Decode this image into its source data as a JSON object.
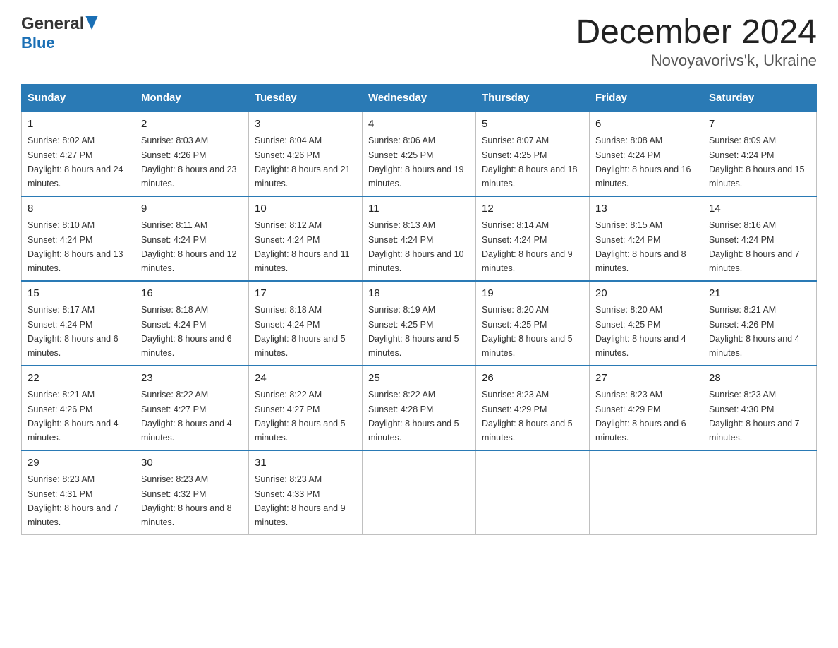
{
  "header": {
    "title": "December 2024",
    "subtitle": "Novoyavorivs'k, Ukraine",
    "logo_general": "General",
    "logo_blue": "Blue"
  },
  "weekdays": [
    "Sunday",
    "Monday",
    "Tuesday",
    "Wednesday",
    "Thursday",
    "Friday",
    "Saturday"
  ],
  "weeks": [
    [
      {
        "day": "1",
        "sunrise": "8:02 AM",
        "sunset": "4:27 PM",
        "daylight": "8 hours and 24 minutes."
      },
      {
        "day": "2",
        "sunrise": "8:03 AM",
        "sunset": "4:26 PM",
        "daylight": "8 hours and 23 minutes."
      },
      {
        "day": "3",
        "sunrise": "8:04 AM",
        "sunset": "4:26 PM",
        "daylight": "8 hours and 21 minutes."
      },
      {
        "day": "4",
        "sunrise": "8:06 AM",
        "sunset": "4:25 PM",
        "daylight": "8 hours and 19 minutes."
      },
      {
        "day": "5",
        "sunrise": "8:07 AM",
        "sunset": "4:25 PM",
        "daylight": "8 hours and 18 minutes."
      },
      {
        "day": "6",
        "sunrise": "8:08 AM",
        "sunset": "4:24 PM",
        "daylight": "8 hours and 16 minutes."
      },
      {
        "day": "7",
        "sunrise": "8:09 AM",
        "sunset": "4:24 PM",
        "daylight": "8 hours and 15 minutes."
      }
    ],
    [
      {
        "day": "8",
        "sunrise": "8:10 AM",
        "sunset": "4:24 PM",
        "daylight": "8 hours and 13 minutes."
      },
      {
        "day": "9",
        "sunrise": "8:11 AM",
        "sunset": "4:24 PM",
        "daylight": "8 hours and 12 minutes."
      },
      {
        "day": "10",
        "sunrise": "8:12 AM",
        "sunset": "4:24 PM",
        "daylight": "8 hours and 11 minutes."
      },
      {
        "day": "11",
        "sunrise": "8:13 AM",
        "sunset": "4:24 PM",
        "daylight": "8 hours and 10 minutes."
      },
      {
        "day": "12",
        "sunrise": "8:14 AM",
        "sunset": "4:24 PM",
        "daylight": "8 hours and 9 minutes."
      },
      {
        "day": "13",
        "sunrise": "8:15 AM",
        "sunset": "4:24 PM",
        "daylight": "8 hours and 8 minutes."
      },
      {
        "day": "14",
        "sunrise": "8:16 AM",
        "sunset": "4:24 PM",
        "daylight": "8 hours and 7 minutes."
      }
    ],
    [
      {
        "day": "15",
        "sunrise": "8:17 AM",
        "sunset": "4:24 PM",
        "daylight": "8 hours and 6 minutes."
      },
      {
        "day": "16",
        "sunrise": "8:18 AM",
        "sunset": "4:24 PM",
        "daylight": "8 hours and 6 minutes."
      },
      {
        "day": "17",
        "sunrise": "8:18 AM",
        "sunset": "4:24 PM",
        "daylight": "8 hours and 5 minutes."
      },
      {
        "day": "18",
        "sunrise": "8:19 AM",
        "sunset": "4:25 PM",
        "daylight": "8 hours and 5 minutes."
      },
      {
        "day": "19",
        "sunrise": "8:20 AM",
        "sunset": "4:25 PM",
        "daylight": "8 hours and 5 minutes."
      },
      {
        "day": "20",
        "sunrise": "8:20 AM",
        "sunset": "4:25 PM",
        "daylight": "8 hours and 4 minutes."
      },
      {
        "day": "21",
        "sunrise": "8:21 AM",
        "sunset": "4:26 PM",
        "daylight": "8 hours and 4 minutes."
      }
    ],
    [
      {
        "day": "22",
        "sunrise": "8:21 AM",
        "sunset": "4:26 PM",
        "daylight": "8 hours and 4 minutes."
      },
      {
        "day": "23",
        "sunrise": "8:22 AM",
        "sunset": "4:27 PM",
        "daylight": "8 hours and 4 minutes."
      },
      {
        "day": "24",
        "sunrise": "8:22 AM",
        "sunset": "4:27 PM",
        "daylight": "8 hours and 5 minutes."
      },
      {
        "day": "25",
        "sunrise": "8:22 AM",
        "sunset": "4:28 PM",
        "daylight": "8 hours and 5 minutes."
      },
      {
        "day": "26",
        "sunrise": "8:23 AM",
        "sunset": "4:29 PM",
        "daylight": "8 hours and 5 minutes."
      },
      {
        "day": "27",
        "sunrise": "8:23 AM",
        "sunset": "4:29 PM",
        "daylight": "8 hours and 6 minutes."
      },
      {
        "day": "28",
        "sunrise": "8:23 AM",
        "sunset": "4:30 PM",
        "daylight": "8 hours and 7 minutes."
      }
    ],
    [
      {
        "day": "29",
        "sunrise": "8:23 AM",
        "sunset": "4:31 PM",
        "daylight": "8 hours and 7 minutes."
      },
      {
        "day": "30",
        "sunrise": "8:23 AM",
        "sunset": "4:32 PM",
        "daylight": "8 hours and 8 minutes."
      },
      {
        "day": "31",
        "sunrise": "8:23 AM",
        "sunset": "4:33 PM",
        "daylight": "8 hours and 9 minutes."
      },
      null,
      null,
      null,
      null
    ]
  ]
}
